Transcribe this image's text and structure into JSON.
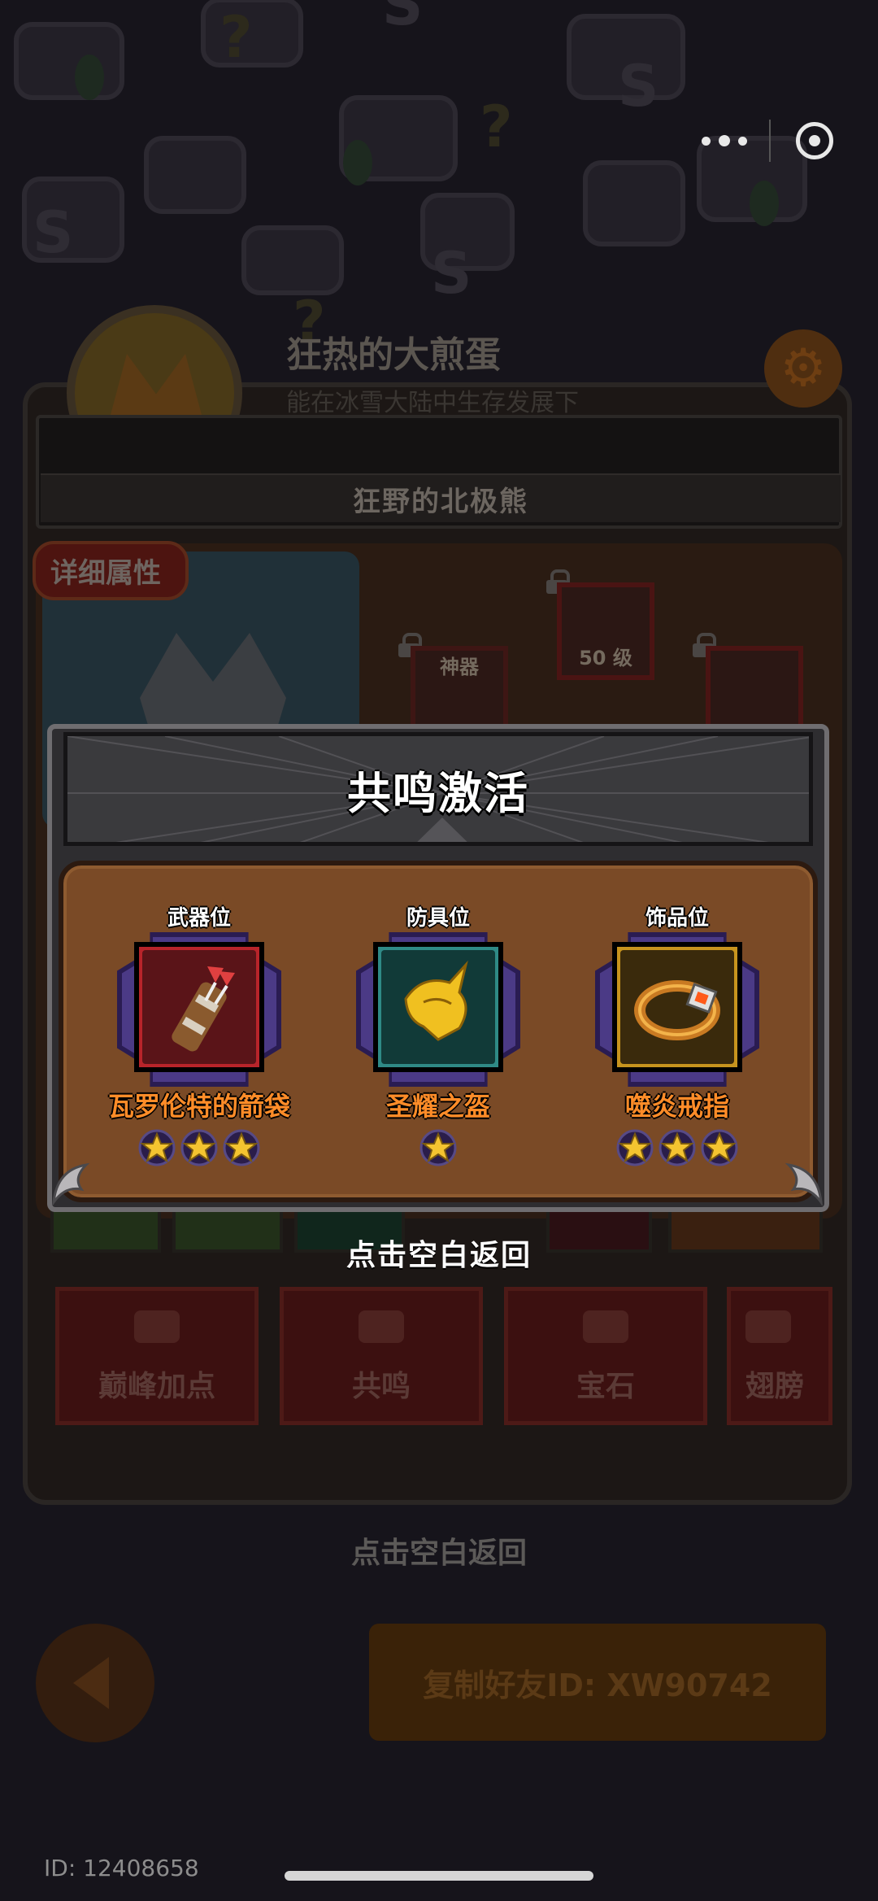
{
  "capsule": {
    "more_icon": "more-dots-icon",
    "close_icon": "target-circle-icon"
  },
  "profile": {
    "player_name": "狂热的大煎蛋",
    "subtitle": "能在冰雪大陆中生存发展下",
    "title_name": "狂野的北极熊",
    "detail_tag": "详细属性",
    "slot_tags": [
      "神器",
      "50 级"
    ]
  },
  "features": [
    "巅峰加点",
    "共鸣",
    "宝石",
    "翅膀"
  ],
  "underlay_hint": "点击空白返回",
  "copy_button": "复制好友ID: XW90742",
  "user_id": "ID: 12408658",
  "modal": {
    "title": "共鸣激活",
    "slots": [
      {
        "label": "武器位",
        "item_name": "瓦罗伦特的箭袋",
        "stars": 3,
        "rarity_color": "#b8242a",
        "icon": "quiver-icon"
      },
      {
        "label": "防具位",
        "item_name": "圣耀之盔",
        "stars": 1,
        "rarity_color": "#2f8a86",
        "icon": "golden-helmet-icon"
      },
      {
        "label": "饰品位",
        "item_name": "噬炎戒指",
        "stars": 3,
        "rarity_color": "#c7941e",
        "icon": "flame-ring-icon"
      }
    ]
  },
  "hint": "点击空白返回",
  "colors": {
    "item_name": "#ff8c28",
    "modal_body": "#7a4a26",
    "star": "#f4c430"
  }
}
